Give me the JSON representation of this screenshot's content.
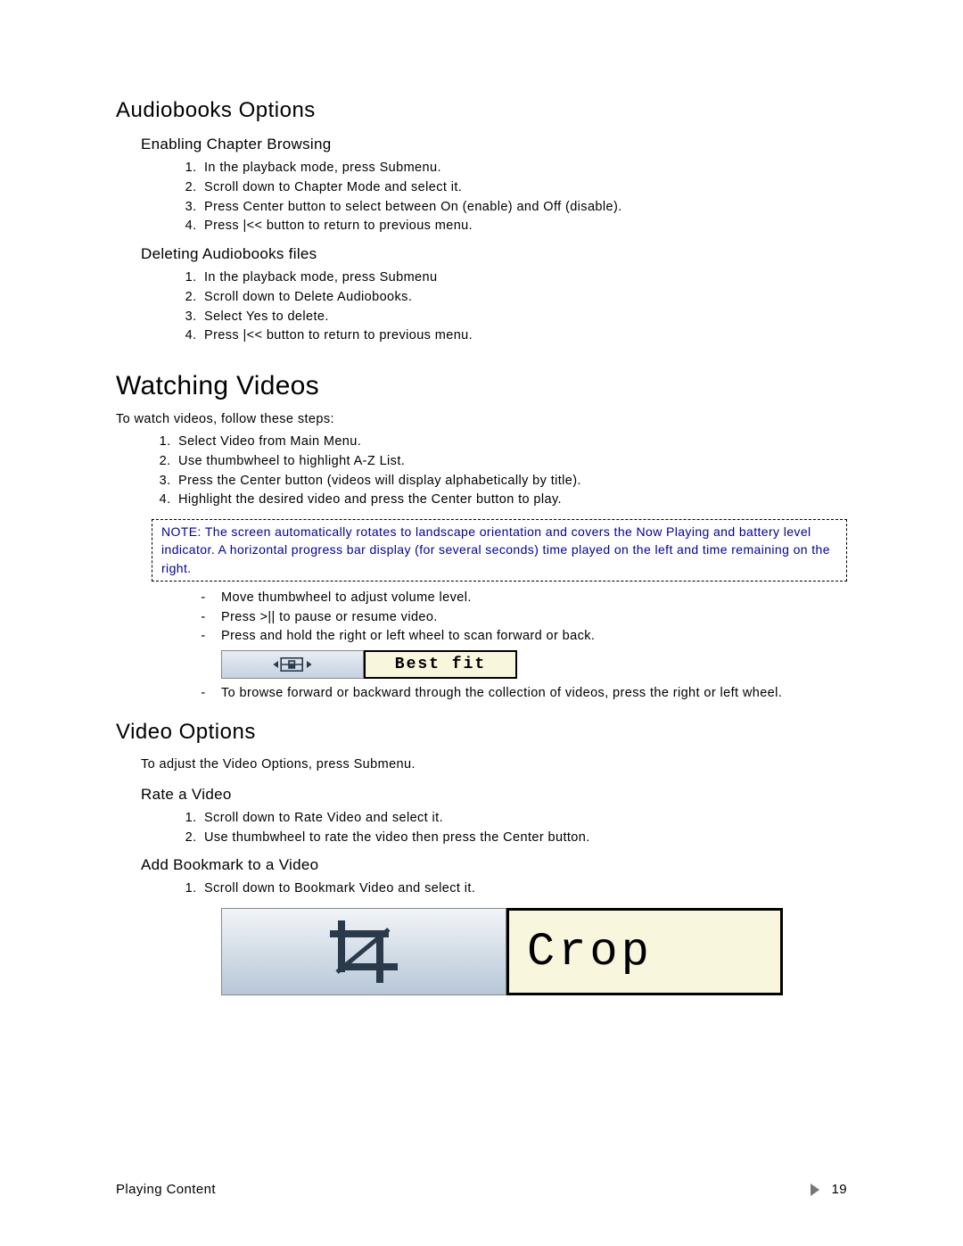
{
  "audiobooks": {
    "heading": "Audiobooks Options",
    "chapter": {
      "heading": "Enabling Chapter Browsing",
      "steps": [
        "In the playback mode, press Submenu.",
        "Scroll down to Chapter Mode and select it.",
        "Press Center button to select between On (enable) and Off (disable).",
        "Press |<< button to return to previous menu."
      ]
    },
    "deleting": {
      "heading": "Deleting Audiobooks files",
      "steps": [
        "In the playback mode, press Submenu",
        "Scroll down to Delete Audiobooks.",
        "Select Yes to delete.",
        "Press |<< button to return to previous menu."
      ]
    }
  },
  "watching": {
    "heading": "Watching Videos",
    "intro": "To watch videos, follow these steps:",
    "steps": [
      "Select Video from Main Menu.",
      "Use thumbwheel to highlight A-Z List.",
      "Press the Center button (videos will display alphabetically by title).",
      "Highlight the desired video and press the Center button to play."
    ],
    "note": "NOTE:  The screen automatically rotates to landscape orientation and covers the Now Playing and battery level indicator.  A horizontal progress bar display (for several seconds) time played on the left and time remaining on the right.",
    "dashes": {
      "d1": "Move thumbwheel to adjust volume level.",
      "d2": "Press >|| to pause or resume video.",
      "d3": "Press and hold the right or left wheel to scan forward or back.",
      "d4": "To browse forward or backward through the collection of videos, press the right or left wheel."
    },
    "best_fit_label": "Best fit"
  },
  "video_options": {
    "heading": "Video Options",
    "intro": "To adjust the Video Options, press Submenu.",
    "rate": {
      "heading": "Rate a Video",
      "steps": [
        "Scroll down to Rate Video and select it.",
        "Use thumbwheel to rate the video then press the Center button."
      ]
    },
    "bookmark": {
      "heading": "Add Bookmark to a Video",
      "steps": [
        "Scroll down to Bookmark Video and select it."
      ],
      "crop_label": "Crop"
    }
  },
  "footer": {
    "section": "Playing Content",
    "page": "19"
  }
}
